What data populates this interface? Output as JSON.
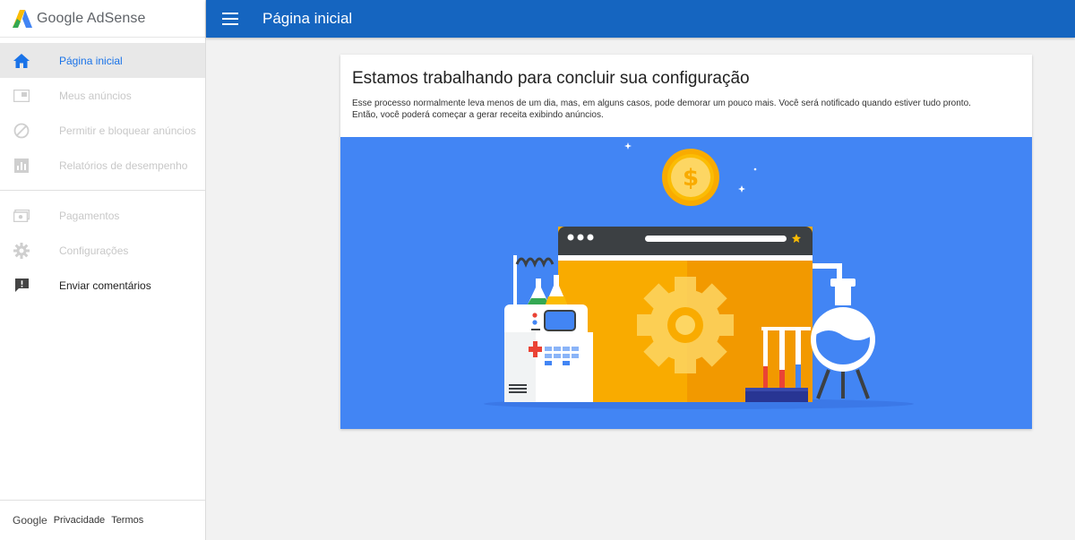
{
  "brand": {
    "name": "Google AdSense"
  },
  "topbar": {
    "title": "Página inicial"
  },
  "sidebar": {
    "items": [
      {
        "label": "Página inicial",
        "icon": "home-icon",
        "state": "active"
      },
      {
        "label": "Meus anúncios",
        "icon": "ad-unit-icon",
        "state": "disabled"
      },
      {
        "label": "Permitir e bloquear anúncios",
        "icon": "block-icon",
        "state": "disabled"
      },
      {
        "label": "Relatórios de desempenho",
        "icon": "bar-chart-icon",
        "state": "disabled"
      },
      {
        "label": "Pagamentos",
        "icon": "payments-icon",
        "state": "disabled"
      },
      {
        "label": "Configurações",
        "icon": "gear-icon",
        "state": "disabled"
      },
      {
        "label": "Enviar comentários",
        "icon": "feedback-icon",
        "state": "normal"
      }
    ]
  },
  "footer": {
    "google": "Google",
    "privacy": "Privacidade",
    "terms": "Termos"
  },
  "card": {
    "title": "Estamos trabalhando para concluir sua configuração",
    "desc_line1": "Esse processo normalmente leva menos de um dia, mas, em alguns casos, pode demorar um pouco mais. Você será notificado quando estiver tudo pronto.",
    "desc_line2": "Então, você poderá começar a gerar receita exibindo anúncios."
  },
  "colors": {
    "topbar": "#1565c0",
    "active_text": "#1a73e8",
    "illustration_bg": "#4285f4",
    "window_orange": "#f9ab00"
  }
}
